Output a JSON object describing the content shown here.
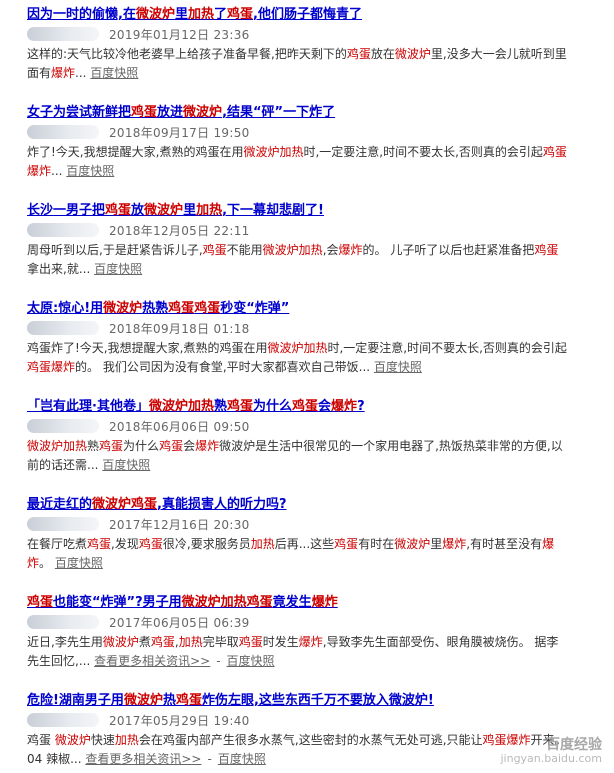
{
  "results": [
    {
      "title": [
        {
          "t": "因为一时的偷懒,在"
        },
        {
          "t": "微波炉",
          "h": 1
        },
        {
          "t": "里"
        },
        {
          "t": "加热",
          "h": 1
        },
        {
          "t": "了"
        },
        {
          "t": "鸡蛋",
          "h": 1
        },
        {
          "t": ",他们肠子都悔青了"
        }
      ],
      "date": "2019年01月12日 23:36",
      "abstract": [
        {
          "t": "这样的:天气比较冷他老婆早上给孩子准备早餐,把昨天剩下的"
        },
        {
          "t": "鸡蛋",
          "h": 1
        },
        {
          "t": "放在"
        },
        {
          "t": "微波炉",
          "h": 1
        },
        {
          "t": "里,没多大一会儿就听到里面有"
        },
        {
          "t": "爆炸",
          "h": 1
        },
        {
          "t": "... "
        }
      ],
      "snapshot": "百度快照"
    },
    {
      "title": [
        {
          "t": "女子为尝试新鲜把"
        },
        {
          "t": "鸡蛋",
          "h": 1
        },
        {
          "t": "放进"
        },
        {
          "t": "微波炉",
          "h": 1
        },
        {
          "t": ",结果“砰”一下炸了"
        }
      ],
      "date": "2018年09月17日 19:50",
      "abstract": [
        {
          "t": "炸了!今天,我想提醒大家,煮熟的鸡蛋在用"
        },
        {
          "t": "微波炉加热",
          "h": 1
        },
        {
          "t": "时,一定要注意,时间不要太长,否则真的会引起"
        },
        {
          "t": "鸡蛋爆炸",
          "h": 1
        },
        {
          "t": "... "
        }
      ],
      "snapshot": "百度快照"
    },
    {
      "title": [
        {
          "t": "长沙一男子把"
        },
        {
          "t": "鸡蛋",
          "h": 1
        },
        {
          "t": "放"
        },
        {
          "t": "微波炉",
          "h": 1
        },
        {
          "t": "里"
        },
        {
          "t": "加热",
          "h": 1
        },
        {
          "t": ",下一幕却悲剧了!"
        }
      ],
      "date": "2018年12月05日 22:11",
      "abstract": [
        {
          "t": "周母听到以后,于是赶紧告诉儿子,"
        },
        {
          "t": "鸡蛋",
          "h": 1
        },
        {
          "t": "不能用"
        },
        {
          "t": "微波炉加热",
          "h": 1
        },
        {
          "t": ",会"
        },
        {
          "t": "爆炸",
          "h": 1
        },
        {
          "t": "的。 儿子听了以后也赶紧准备把"
        },
        {
          "t": "鸡蛋",
          "h": 1
        },
        {
          "t": "拿出来,就... "
        }
      ],
      "snapshot": "百度快照"
    },
    {
      "title": [
        {
          "t": "太原:惊心!用"
        },
        {
          "t": "微波炉",
          "h": 1
        },
        {
          "t": "热熟"
        },
        {
          "t": "鸡蛋",
          "h": 1
        },
        {
          "t": "鸡蛋",
          "h": 1
        },
        {
          "t": "秒变“炸弹”"
        }
      ],
      "date": "2018年09月18日 01:18",
      "abstract": [
        {
          "t": "鸡蛋炸了!今天,我想提醒大家,煮熟的鸡蛋在用"
        },
        {
          "t": "微波炉加热",
          "h": 1
        },
        {
          "t": "时,一定要注意,时间不要太长,否则真的会引起"
        },
        {
          "t": "鸡蛋爆炸",
          "h": 1
        },
        {
          "t": "的。 我们公司因为没有食堂,平时大家都喜欢自己带饭... "
        }
      ],
      "snapshot": "百度快照"
    },
    {
      "title": [
        {
          "t": "「岂有此理·其他卷」"
        },
        {
          "t": "微波炉加热",
          "h": 1
        },
        {
          "t": "熟"
        },
        {
          "t": "鸡蛋",
          "h": 1
        },
        {
          "t": "为什么"
        },
        {
          "t": "鸡蛋",
          "h": 1
        },
        {
          "t": "会"
        },
        {
          "t": "爆炸",
          "h": 1
        },
        {
          "t": "?"
        }
      ],
      "date": "2018年06月06日 09:50",
      "abstract": [
        {
          "t": "微波炉加热",
          "h": 1
        },
        {
          "t": "熟"
        },
        {
          "t": "鸡蛋",
          "h": 1
        },
        {
          "t": "为什么"
        },
        {
          "t": "鸡蛋",
          "h": 1
        },
        {
          "t": "会"
        },
        {
          "t": "爆炸",
          "h": 1
        },
        {
          "t": "微波炉是生活中很常见的一个家用电器了,热饭热菜非常的方便,以前的话还需... "
        }
      ],
      "snapshot": "百度快照"
    },
    {
      "title": [
        {
          "t": "最近走红的"
        },
        {
          "t": "微波炉鸡蛋",
          "h": 1
        },
        {
          "t": ",真能损害人的听力吗?"
        }
      ],
      "date": "2017年12月16日 20:30",
      "abstract": [
        {
          "t": "在餐厅吃煮"
        },
        {
          "t": "鸡蛋",
          "h": 1
        },
        {
          "t": ",发现"
        },
        {
          "t": "鸡蛋",
          "h": 1
        },
        {
          "t": "很冷,要求服务员"
        },
        {
          "t": "加热",
          "h": 1
        },
        {
          "t": "后再...这些"
        },
        {
          "t": "鸡蛋",
          "h": 1
        },
        {
          "t": "有时在"
        },
        {
          "t": "微波炉",
          "h": 1
        },
        {
          "t": "里"
        },
        {
          "t": "爆炸",
          "h": 1
        },
        {
          "t": ",有时甚至没有"
        },
        {
          "t": "爆炸",
          "h": 1
        },
        {
          "t": "。 "
        }
      ],
      "snapshot": "百度快照"
    },
    {
      "title": [
        {
          "t": "鸡蛋",
          "h": 1
        },
        {
          "t": "也能变“炸弹”?男子用"
        },
        {
          "t": "微波炉加热鸡蛋",
          "h": 1
        },
        {
          "t": "竟发生"
        },
        {
          "t": "爆炸",
          "h": 1
        }
      ],
      "date": "2017年06月05日 06:39",
      "abstract": [
        {
          "t": "近日,李先生用"
        },
        {
          "t": "微波炉",
          "h": 1
        },
        {
          "t": "煮"
        },
        {
          "t": "鸡蛋",
          "h": 1
        },
        {
          "t": ","
        },
        {
          "t": "加热",
          "h": 1
        },
        {
          "t": "完毕取"
        },
        {
          "t": "鸡蛋",
          "h": 1
        },
        {
          "t": "时发生"
        },
        {
          "t": "爆炸",
          "h": 1
        },
        {
          "t": ",导致李先生面部受伤、眼角膜被烧伤。 据李先生回忆,... "
        }
      ],
      "more": "查看更多相关资讯>>",
      "snapshot": "百度快照"
    },
    {
      "title": [
        {
          "t": "危险!湖南男子用"
        },
        {
          "t": "微波炉",
          "h": 1
        },
        {
          "t": "热"
        },
        {
          "t": "鸡蛋",
          "h": 1
        },
        {
          "t": "炸伤左眼,这些东西千万不要放入微波炉!"
        }
      ],
      "date": "2017年05月29日 19:40",
      "abstract": [
        {
          "t": "鸡蛋 "
        },
        {
          "t": "微波炉",
          "h": 1
        },
        {
          "t": "快速"
        },
        {
          "t": "加热",
          "h": 1
        },
        {
          "t": "会在鸡蛋内部产生很多水蒸气,这些密封的水蒸气无处可逃,只能让"
        },
        {
          "t": "鸡蛋爆炸",
          "h": 1
        },
        {
          "t": "开来。 04 辣椒... "
        }
      ],
      "more": "查看更多相关资讯>>",
      "snapshot": "百度快照"
    }
  ],
  "separator": "-",
  "watermark": {
    "line1": "百度经验",
    "line2": "jingyan.baidu.com"
  }
}
